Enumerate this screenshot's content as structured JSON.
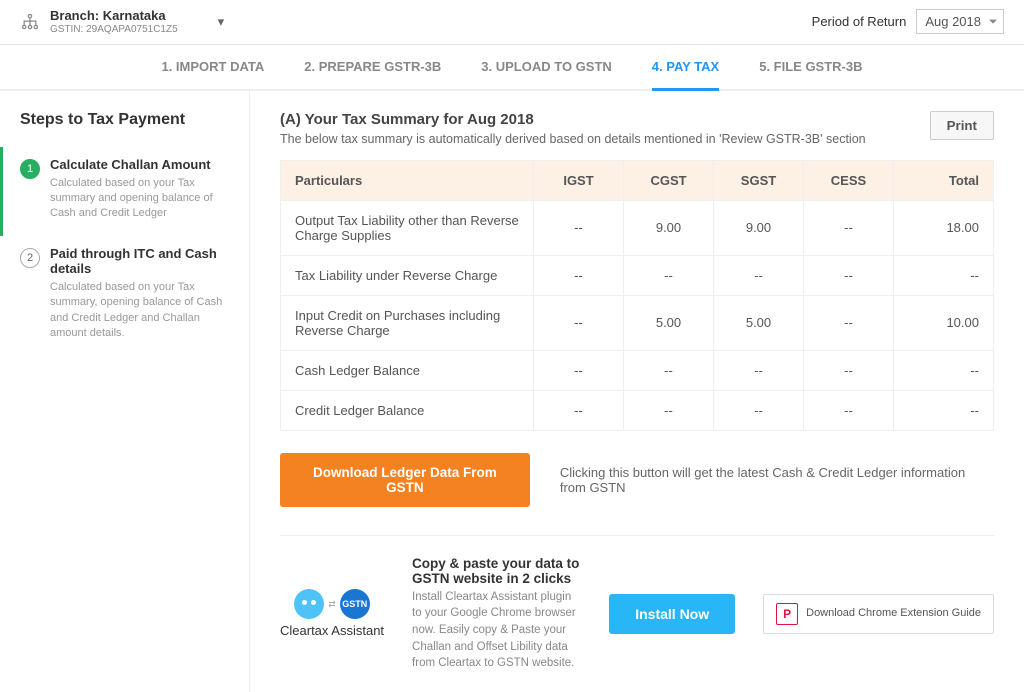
{
  "header": {
    "branch_label": "Branch:",
    "branch_name": "Karnataka",
    "gstin_label": "GSTIN:",
    "gstin": "29AQAPA0751C1Z5",
    "period_label": "Period of Return",
    "period_value": "Aug 2018"
  },
  "nav": {
    "s1": "1. IMPORT DATA",
    "s2": "2. PREPARE GSTR-3B",
    "s3": "3. UPLOAD TO GSTN",
    "s4": "4. PAY TAX",
    "s5": "5. FILE GSTR-3B"
  },
  "sidebar": {
    "heading": "Steps to Tax Payment",
    "step1_title": "Calculate Challan Amount",
    "step1_desc": "Calculated based on your Tax summary and opening balance of Cash and Credit Ledger",
    "step2_title": "Paid through ITC and Cash details",
    "step2_desc": "Calculated based on your Tax summary, opening balance of Cash and Credit Ledger and Challan amount details."
  },
  "summary": {
    "title": "(A) Your Tax Summary for Aug 2018",
    "subtitle": "The below tax summary is automatically derived based on details mentioned in 'Review GSTR-3B' section",
    "print": "Print",
    "cols": {
      "c0": "Particulars",
      "c1": "IGST",
      "c2": "CGST",
      "c3": "SGST",
      "c4": "CESS",
      "c5": "Total"
    },
    "rows": [
      {
        "p": "Output Tax Liability other than Reverse Charge Supplies",
        "igst": "--",
        "cgst": "9.00",
        "sgst": "9.00",
        "cess": "--",
        "total": "18.00"
      },
      {
        "p": "Tax Liability under Reverse Charge",
        "igst": "--",
        "cgst": "--",
        "sgst": "--",
        "cess": "--",
        "total": "--"
      },
      {
        "p": "Input Credit on Purchases including Reverse Charge",
        "igst": "--",
        "cgst": "5.00",
        "sgst": "5.00",
        "cess": "--",
        "total": "10.00"
      },
      {
        "p": "Cash Ledger Balance",
        "igst": "--",
        "cgst": "--",
        "sgst": "--",
        "cess": "--",
        "total": "--"
      },
      {
        "p": "Credit Ledger Balance",
        "igst": "--",
        "cgst": "--",
        "sgst": "--",
        "cess": "--",
        "total": "--"
      }
    ]
  },
  "download": {
    "button": "Download Ledger Data From GSTN",
    "note": "Clicking this button will get the latest Cash & Credit Ledger information from GSTN"
  },
  "assistant": {
    "brand": "Cleartax Assistant",
    "title": "Copy & paste your data to GSTN website in 2 clicks",
    "desc": "Install Cleartax Assistant plugin to your Google Chrome browser now. Easily copy & Paste your Challan and Offset Libility data from Cleartax to GSTN website.",
    "install": "Install Now",
    "guide": "Download Chrome Extension Guide",
    "p_icon": "P"
  }
}
